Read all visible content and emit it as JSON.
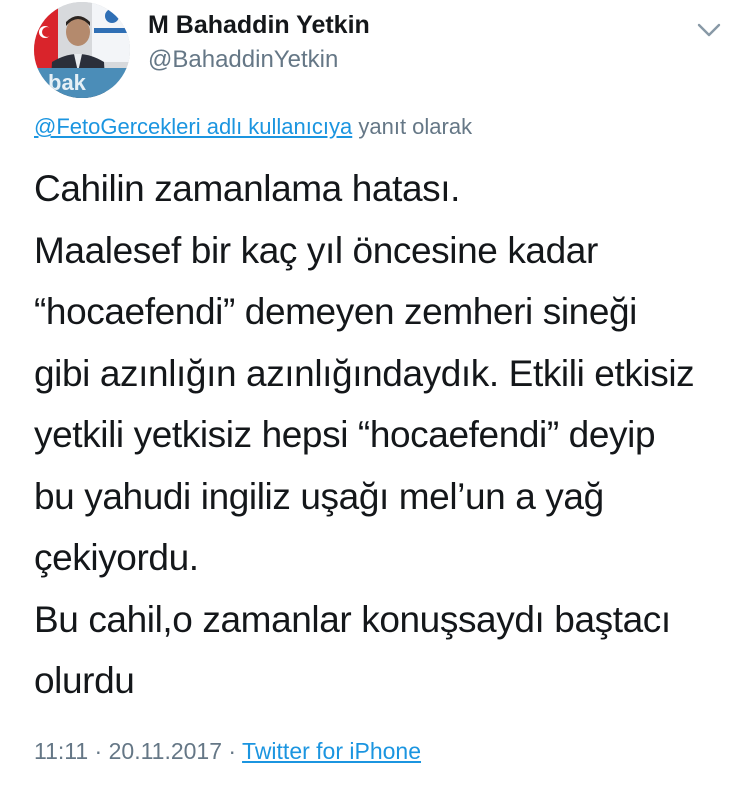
{
  "user": {
    "display_name": "M Bahaddin Yetkin",
    "handle": "@BahaddinYetkin",
    "avatar_icon": "profile-photo"
  },
  "menu": {
    "icon": "chevron-down-icon"
  },
  "reply": {
    "link_text": "@FetoGercekleri adlı kullanıcıya",
    "suffix_text": " yanıt olarak"
  },
  "tweet": {
    "text": "Cahilin zamanlama hatası.\nMaalesef bir kaç yıl öncesine kadar\n“hocaefendi” demeyen zemheri sineği\ngibi azınlığın azınlığındaydık. Etkili etkisiz\nyetkili yetkisiz hepsi “hocaefendi” deyip\nbu yahudi ingiliz uşağı mel’un a yağ\nçekiyordu.\nBu cahil,o zamanlar konuşsaydı baştacı\nolurdu"
  },
  "meta": {
    "time": "11:11",
    "separator": " · ",
    "date": "20.11.2017",
    "separator2": " · ",
    "source": "Twitter for iPhone"
  },
  "colors": {
    "link": "#1b95e0",
    "secondary_text": "#657786",
    "primary_text": "#14171a"
  }
}
